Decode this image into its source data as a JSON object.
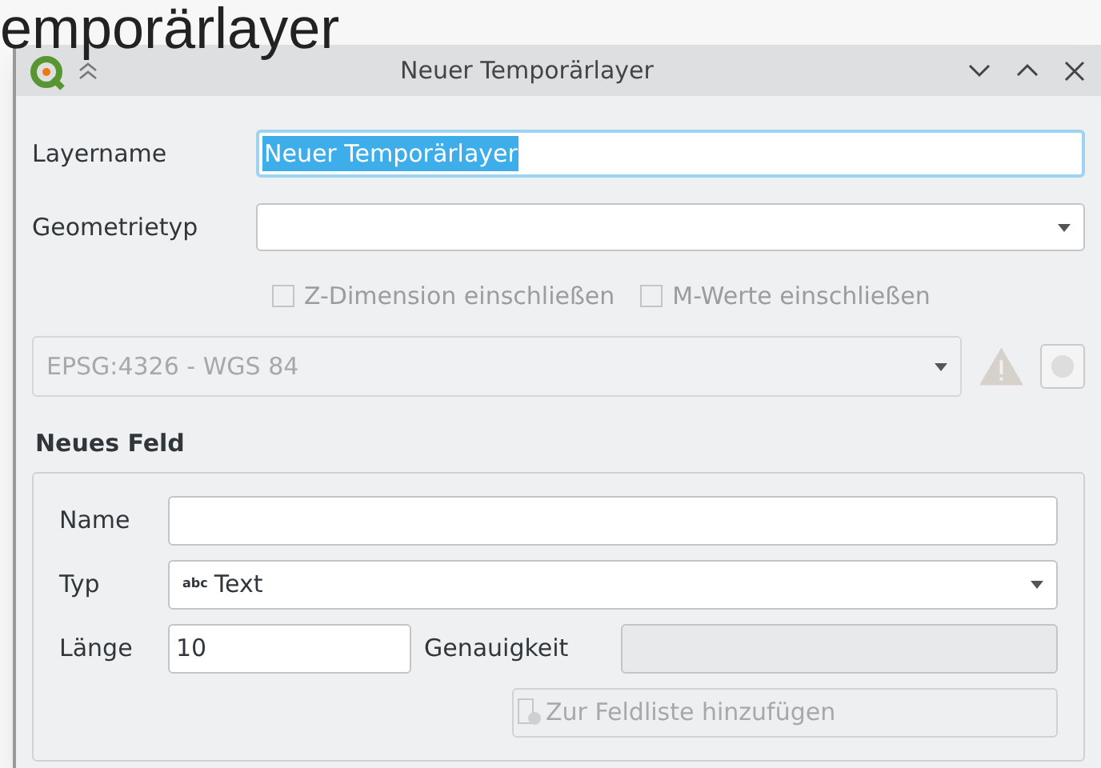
{
  "background": {
    "title_fragment": "emporärlayer"
  },
  "window": {
    "title": "Neuer Temporärlayer"
  },
  "layername": {
    "label": "Layername",
    "value": "Neuer Temporärlayer",
    "selected": true
  },
  "geometrietyp": {
    "label": "Geometrietyp"
  },
  "checkboxes": [
    {
      "label": "Z-Dimension einschließen",
      "checked": false,
      "disabled": true
    },
    {
      "label": "M-Werte einschließen",
      "checked": false,
      "disabled": true
    }
  ],
  "crs": {
    "value": "EPSG:4326 - WGS 84",
    "disabled": true
  },
  "new_field": {
    "title": "Neues Feld",
    "name": {
      "label": "Name"
    },
    "type": {
      "label": "Typ",
      "value": "Text",
      "icon_text": "abc"
    },
    "length": {
      "label": "Länge",
      "value": "10"
    },
    "precision": {
      "label": "Genauigkeit",
      "disabled": true
    },
    "add_button": {
      "label": "Zur Feldliste hinzufügen",
      "disabled": true
    }
  }
}
